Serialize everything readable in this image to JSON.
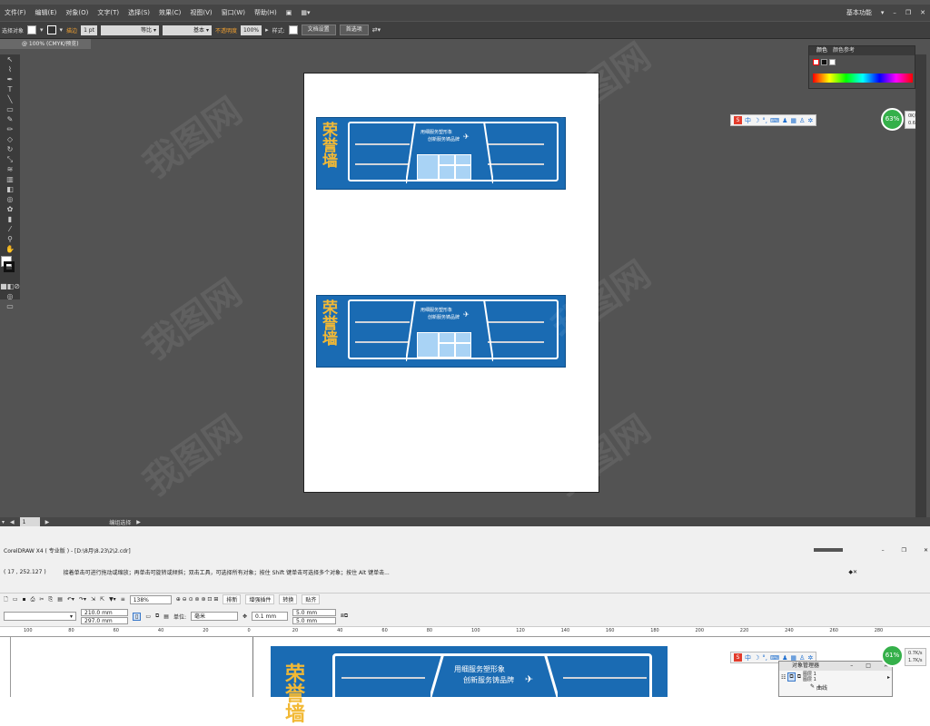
{
  "illustrator": {
    "menu": [
      "文件(F)",
      "编辑(E)",
      "对象(O)",
      "文字(T)",
      "选择(S)",
      "效果(C)",
      "视图(V)",
      "窗口(W)",
      "帮助(H)"
    ],
    "workspace_label": "基本功能",
    "control_bar": {
      "selection_label": "选择对象",
      "stroke_label": "描边",
      "stroke_value": "1 pt",
      "stroke_style_1": "等比",
      "stroke_style_2": "基本",
      "opacity_label": "不透明度",
      "opacity_value": "100%",
      "style_label": "样式:",
      "doc_setup_button": "文档设置",
      "preferences_button": "首选项"
    },
    "doc_tab": "@ 100% (CMYK/预览)",
    "status_zoom": "1",
    "status_text": "编组选择",
    "color_panel": {
      "tab1": "颜色",
      "tab2": "颜色参考"
    },
    "banner": {
      "title": "荣誉墙",
      "slogan1": "用细服务塑形象",
      "slogan2": "创新服务铸品牌"
    },
    "ime": {
      "icon": "S",
      "label": "中"
    },
    "net_ball_1": {
      "percent": "63%",
      "up": "0K/s",
      "down": "0.6K/s"
    }
  },
  "coreldraw": {
    "title": "CorelDRAW X4 ( 专业版 ) - [D:\\8月\\8.23\\2\\2.cdr]",
    "coords": "( 17 , 252.127 )",
    "hint": "接着单击可进行拖动或缩放；再单击可旋转或倾斜；双击工具，可选择所有对象；按住 Shift 键单击可选择多个对象；按住 Alt 键单击...",
    "zoom_value": "138%",
    "buttons": [
      "排新",
      "增强插件",
      "转换",
      "贴齐"
    ],
    "page_width": "210.0 mm",
    "page_height": "297.0 mm",
    "unit_label": "单位:",
    "unit_value": "毫米",
    "nudge_value": "0.1 mm",
    "dup_x": "5.0 mm",
    "dup_y": "5.0 mm",
    "ruler_marks": [
      "100",
      "80",
      "60",
      "40",
      "20",
      "0",
      "20",
      "40",
      "60",
      "80",
      "100",
      "120",
      "140",
      "160",
      "180",
      "200",
      "220",
      "240",
      "260",
      "280"
    ],
    "banner": {
      "title": "荣誉墙",
      "slogan1": "用细服务塑形象",
      "slogan2": "创新服务铸品牌"
    },
    "object_manager": {
      "title": "对象管理器",
      "layer_label": "图层 1",
      "item_label": "图层 1",
      "curve_label": "曲线"
    },
    "ime": {
      "icon": "S",
      "label": "中"
    },
    "net_ball_2": {
      "percent": "61%",
      "up": "0.7K/s",
      "down": "1.7K/s"
    }
  },
  "colors": {
    "banner_blue": "#1a6bb3",
    "title_gold": "#f2b935",
    "light_blue_box": "#a9d3f5"
  }
}
